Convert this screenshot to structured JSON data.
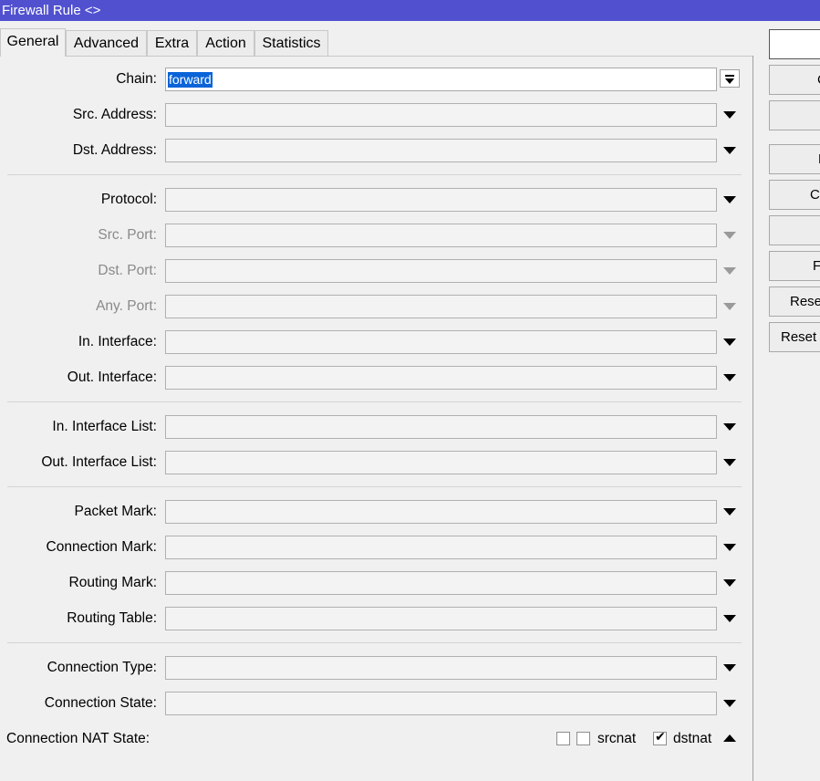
{
  "window": {
    "title": "Firewall Rule <>"
  },
  "tabs": [
    {
      "label": "General"
    },
    {
      "label": "Advanced"
    },
    {
      "label": "Extra"
    },
    {
      "label": "Action"
    },
    {
      "label": "Statistics"
    }
  ],
  "form": {
    "chain": {
      "label": "Chain:",
      "value": "forward"
    },
    "src_address": {
      "label": "Src. Address:"
    },
    "dst_address": {
      "label": "Dst. Address:"
    },
    "protocol": {
      "label": "Protocol:"
    },
    "src_port": {
      "label": "Src. Port:"
    },
    "dst_port": {
      "label": "Dst. Port:"
    },
    "any_port": {
      "label": "Any. Port:"
    },
    "in_interface": {
      "label": "In. Interface:"
    },
    "out_interface": {
      "label": "Out. Interface:"
    },
    "in_interface_list": {
      "label": "In. Interface List:"
    },
    "out_interface_list": {
      "label": "Out. Interface List:"
    },
    "packet_mark": {
      "label": "Packet Mark:"
    },
    "connection_mark": {
      "label": "Connection Mark:"
    },
    "routing_mark": {
      "label": "Routing Mark:"
    },
    "routing_table": {
      "label": "Routing Table:"
    },
    "connection_type": {
      "label": "Connection Type:"
    },
    "connection_state": {
      "label": "Connection State:"
    },
    "connection_nat_state": {
      "label": "Connection NAT State:",
      "options": [
        {
          "label": "srcnat",
          "checked": false
        },
        {
          "label": "dstnat",
          "checked": true
        }
      ],
      "check_mark": "✔"
    }
  },
  "side_buttons": [
    {
      "label": ""
    },
    {
      "label": "C"
    },
    {
      "label": ""
    },
    {
      "label": "E"
    },
    {
      "label": "C"
    },
    {
      "label": ""
    },
    {
      "label": "F"
    },
    {
      "label": "Rese"
    },
    {
      "label": "Reset"
    }
  ],
  "colors": {
    "title_bar": "#5151d0",
    "selection": "#0a64d8",
    "background": "#f0f0f0"
  }
}
